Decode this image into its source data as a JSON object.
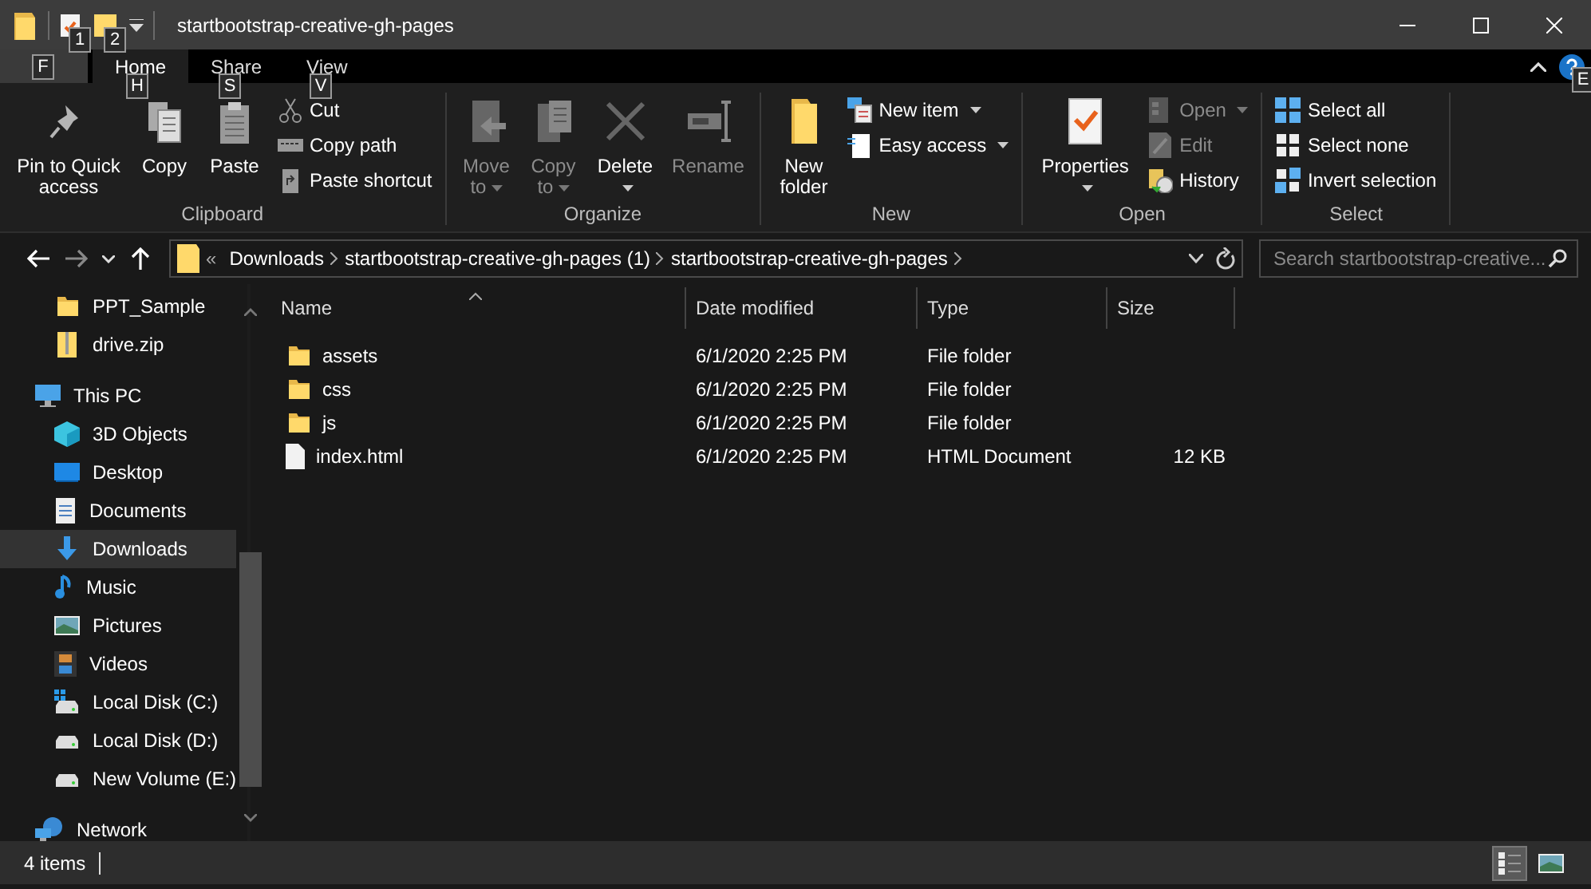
{
  "window": {
    "title": "startbootstrap-creative-gh-pages",
    "quick_access_keytips": [
      "1",
      "2"
    ]
  },
  "ribbon_tabs": {
    "file_keytip": "F",
    "help_keytip": "E",
    "tabs": [
      {
        "label": "Home",
        "keytip": "H",
        "selected": true
      },
      {
        "label": "Share",
        "keytip": "S",
        "selected": false
      },
      {
        "label": "View",
        "keytip": "V",
        "selected": false
      }
    ]
  },
  "ribbon": {
    "groups": [
      {
        "label": "Clipboard",
        "items": [
          {
            "kind": "large",
            "label": "Pin to Quick access",
            "dropdown": false,
            "disabled": false
          },
          {
            "kind": "large",
            "label": "Copy",
            "dropdown": false,
            "disabled": false
          },
          {
            "kind": "large",
            "label": "Paste",
            "dropdown": false,
            "disabled": false
          },
          {
            "kind": "stack",
            "items": [
              {
                "label": "Cut",
                "dropdown": false,
                "disabled": false
              },
              {
                "label": "Copy path",
                "dropdown": false,
                "disabled": false
              },
              {
                "label": "Paste shortcut",
                "dropdown": false,
                "disabled": false
              }
            ]
          }
        ]
      },
      {
        "label": "Organize",
        "items": [
          {
            "kind": "large",
            "label": "Move to",
            "dropdown": true,
            "disabled": true
          },
          {
            "kind": "large",
            "label": "Copy to",
            "dropdown": true,
            "disabled": true
          },
          {
            "kind": "large",
            "label": "Delete",
            "dropdown": true,
            "disabled": false
          },
          {
            "kind": "large",
            "label": "Rename",
            "dropdown": false,
            "disabled": true
          }
        ]
      },
      {
        "label": "New",
        "items": [
          {
            "kind": "large",
            "label": "New folder",
            "dropdown": false,
            "disabled": false
          },
          {
            "kind": "stack",
            "items": [
              {
                "label": "New item",
                "dropdown": true,
                "disabled": false
              },
              {
                "label": "Easy access",
                "dropdown": true,
                "disabled": false
              }
            ]
          }
        ]
      },
      {
        "label": "Open",
        "items": [
          {
            "kind": "large",
            "label": "Properties",
            "dropdown": true,
            "disabled": false
          },
          {
            "kind": "stack",
            "items": [
              {
                "label": "Open",
                "dropdown": true,
                "disabled": true
              },
              {
                "label": "Edit",
                "dropdown": false,
                "disabled": true
              },
              {
                "label": "History",
                "dropdown": false,
                "disabled": false
              }
            ]
          }
        ]
      },
      {
        "label": "Select",
        "items": [
          {
            "kind": "stack",
            "items": [
              {
                "label": "Select all",
                "dropdown": false,
                "disabled": false
              },
              {
                "label": "Select none",
                "dropdown": false,
                "disabled": false
              },
              {
                "label": "Invert selection",
                "dropdown": false,
                "disabled": false
              }
            ]
          }
        ]
      }
    ]
  },
  "address_bar": {
    "overflow": "«",
    "crumbs": [
      "Downloads",
      "startbootstrap-creative-gh-pages (1)",
      "startbootstrap-creative-gh-pages"
    ]
  },
  "search": {
    "placeholder": "Search startbootstrap-creative..."
  },
  "sidebar": {
    "items": [
      {
        "children": [
          {
            "kind": "folder",
            "label": "PPT_Sample",
            "selected": false
          },
          {
            "kind": "archive",
            "label": "drive.zip",
            "selected": false
          }
        ]
      },
      {
        "kind": "computer",
        "label": "This PC",
        "selected": false,
        "children": [
          {
            "kind": "objects",
            "label": "3D Objects",
            "selected": false
          },
          {
            "kind": "desktop",
            "label": "Desktop",
            "selected": false
          },
          {
            "kind": "documents",
            "label": "Documents",
            "selected": false
          },
          {
            "kind": "downloads",
            "label": "Downloads",
            "selected": true
          },
          {
            "kind": "music",
            "label": "Music",
            "selected": false
          },
          {
            "kind": "pictures",
            "label": "Pictures",
            "selected": false
          },
          {
            "kind": "videos",
            "label": "Videos",
            "selected": false
          },
          {
            "kind": "systemdrive",
            "label": "Local Disk (C:)",
            "selected": false
          },
          {
            "kind": "drive",
            "label": "Local Disk (D:)",
            "selected": false
          },
          {
            "kind": "drive",
            "label": "New Volume (E:)",
            "selected": false
          }
        ]
      },
      {
        "kind": "network",
        "label": "Network",
        "selected": false
      }
    ]
  },
  "table": {
    "columns": [
      "Name",
      "Date modified",
      "Type",
      "Size"
    ],
    "rows": [
      {
        "kind": "folder",
        "name": "assets",
        "date_modified": "6/1/2020 2:25 PM",
        "type": "File folder"
      },
      {
        "kind": "folder",
        "name": "css",
        "date_modified": "6/1/2020 2:25 PM",
        "type": "File folder"
      },
      {
        "kind": "folder",
        "name": "js",
        "date_modified": "6/1/2020 2:25 PM",
        "type": "File folder"
      },
      {
        "kind": "file",
        "name": "index.html",
        "date_modified": "6/1/2020 2:25 PM",
        "type": "HTML Document",
        "size": "12 KB"
      }
    ]
  },
  "status_bar": {
    "text": "4 items",
    "view_buttons": [
      {
        "selected": true
      },
      {
        "selected": false
      }
    ]
  }
}
